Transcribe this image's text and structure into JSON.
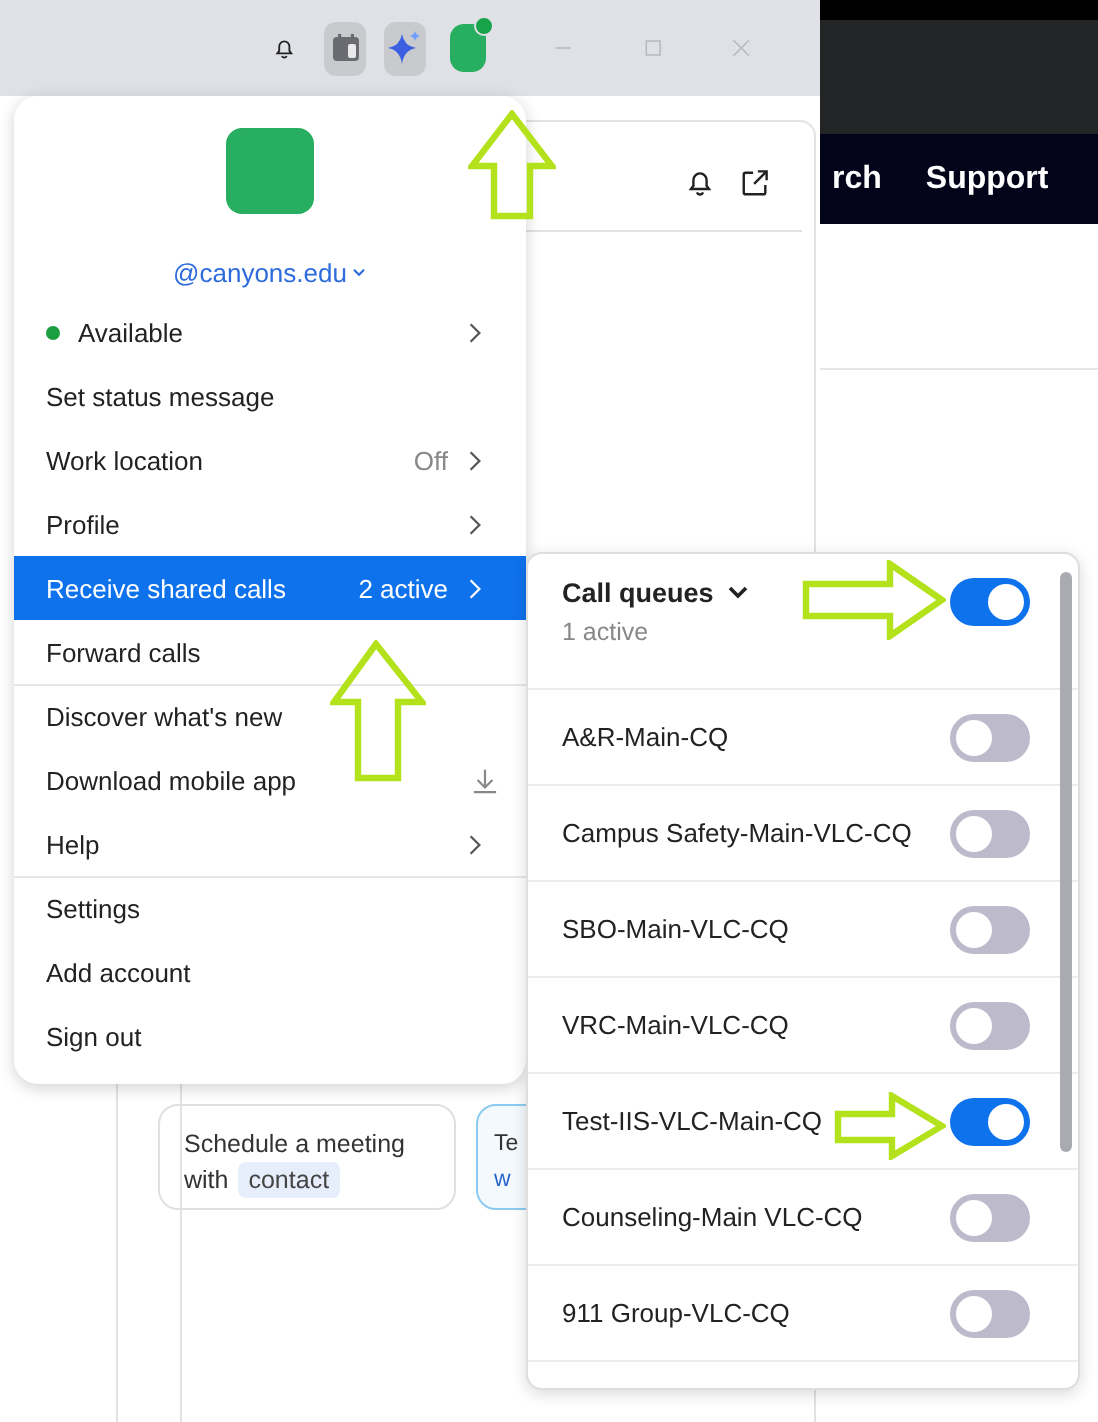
{
  "browser": {
    "nav_items": [
      "rch",
      "Support"
    ]
  },
  "cards": [
    {
      "kind": "suggestion",
      "text": "Schedule a meeting",
      "text2": "with",
      "chip": "contact"
    },
    {
      "kind": "tip",
      "text": "Te",
      "text2": "w"
    }
  ],
  "menu": {
    "account": "@canyons.edu",
    "groups": [
      [
        {
          "kind": "status",
          "label": "Available",
          "selected": false
        },
        {
          "kind": "plain",
          "label": "Set status message",
          "selected": false
        },
        {
          "kind": "submenu",
          "label": "Work location",
          "value": "Off",
          "selected": false
        },
        {
          "kind": "submenu",
          "label": "Profile",
          "selected": false
        },
        {
          "kind": "submenu",
          "label": "Receive shared calls",
          "value": "2 active",
          "selected": true
        },
        {
          "kind": "plain",
          "label": "Forward calls",
          "selected": false
        }
      ],
      [
        {
          "kind": "plain",
          "label": "Discover what's new",
          "selected": false
        },
        {
          "kind": "download",
          "label": "Download mobile app",
          "selected": false
        },
        {
          "kind": "submenu",
          "label": "Help",
          "selected": false
        }
      ],
      [
        {
          "kind": "plain",
          "label": "Settings",
          "selected": false
        },
        {
          "kind": "plain",
          "label": "Add account",
          "selected": false
        },
        {
          "kind": "plain",
          "label": "Sign out",
          "selected": false
        }
      ]
    ]
  },
  "submenu": {
    "title": "Call queues",
    "subtitle": "1 active",
    "on": true,
    "queues": [
      {
        "name": "A&R-Main-CQ",
        "on": false
      },
      {
        "name": "Campus Safety-Main-VLC-CQ",
        "on": false
      },
      {
        "name": "SBO-Main-VLC-CQ",
        "on": false
      },
      {
        "name": "VRC-Main-VLC-CQ",
        "on": false
      },
      {
        "name": "Test-IIS-VLC-Main-CQ",
        "on": true
      },
      {
        "name": "Counseling-Main VLC-CQ",
        "on": false
      },
      {
        "name": "911 Group-VLC-CQ",
        "on": false
      }
    ]
  }
}
